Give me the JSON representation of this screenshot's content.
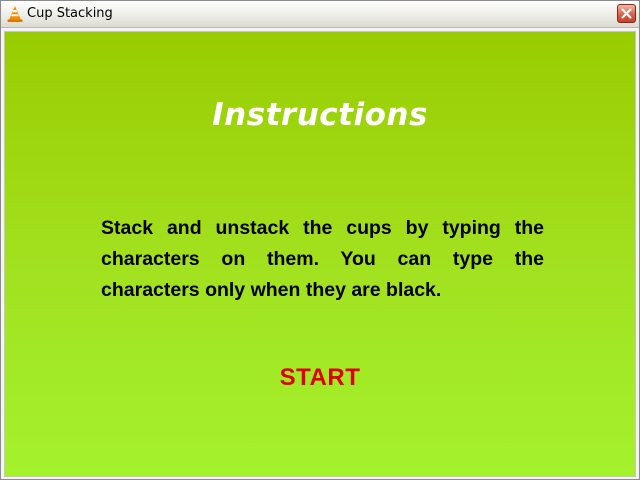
{
  "window": {
    "title": "Cup Stacking",
    "app_icon": "traffic-cone-icon",
    "close_icon": "close-icon"
  },
  "screen": {
    "heading": "Instructions",
    "instructions": "Stack and unstack the cups by typing the characters on them. You can type the characters only when they are black.",
    "start_label": "START"
  },
  "colors": {
    "background_top": "#99cc00",
    "background_bottom": "#a4f22c",
    "heading": "#ffffff",
    "body_text": "#000000",
    "start": "#e10000",
    "close_button": "#d9634a"
  }
}
